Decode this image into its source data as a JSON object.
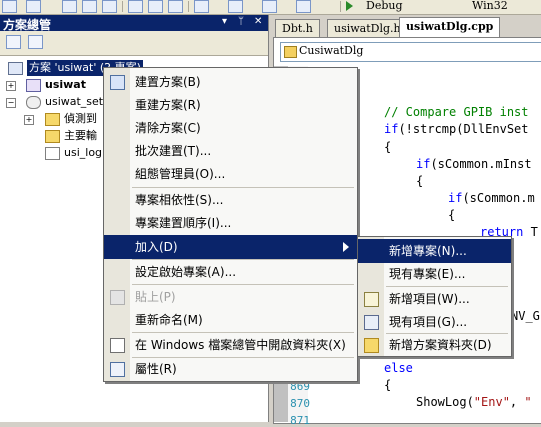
{
  "toolbar": {
    "debug_config": "Debug",
    "platform": "Win32"
  },
  "solution_explorer": {
    "title": "方案總管",
    "pin_glyph": "▾ ⊥ ✕",
    "tree": {
      "solution": "方案 'usiwat' (2 專案)",
      "project1": "usiwat",
      "project2": "usiwat_setup",
      "child_detect": "偵測到",
      "child_main": "主要輸",
      "child_log": "usi_log"
    }
  },
  "editor": {
    "tabs": [
      "Dbt.h",
      "usiwatDlg.h",
      "usiwatDlg.cpp"
    ],
    "class_combo": "CusiwatDlg",
    "code": {
      "l1_comment": "// Compare GPIB inst",
      "l2_if": "if",
      "l2_rest": "(!strcmp(DllEnvSet",
      "l3": "{",
      "l4_if": "if",
      "l4_rest": "(sCommon.mInst",
      "l5": "{",
      "l6_if": "if",
      "l6_rest": "(sCommon.m",
      "l7": "{",
      "l8_return": "return",
      "l8_rest": " T",
      "l9_rest": "NV_G",
      "l10_else": "else",
      "l11": "{",
      "l12_fn": "ShowLog(",
      "l12_str1": "\"Env\"",
      "l12_comma": ", ",
      "l12_str2": "\""
    },
    "line_numbers": [
      "869",
      "870",
      "871"
    ]
  },
  "context_menu": {
    "items": [
      {
        "label": "建置方案(B)",
        "icon": "build-icon"
      },
      {
        "label": "重建方案(R)"
      },
      {
        "label": "清除方案(C)"
      },
      {
        "label": "批次建置(T)..."
      },
      {
        "label": "組態管理員(O)..."
      },
      {
        "label": "專案相依性(S)..."
      },
      {
        "label": "專案建置順序(I)..."
      },
      {
        "label": "加入(D)"
      },
      {
        "label": "設定啟始專案(A)..."
      },
      {
        "label": "貼上(P)",
        "icon": "paste-icon"
      },
      {
        "label": "重新命名(M)"
      },
      {
        "label": "在 Windows 檔案總管中開啟資料夾(X)",
        "icon": "open-folder-icon"
      },
      {
        "label": "屬性(R)",
        "icon": "properties-icon"
      }
    ]
  },
  "submenu": {
    "items": [
      {
        "label": "新增專案(N)..."
      },
      {
        "label": "現有專案(E)..."
      },
      {
        "label": "新增項目(W)...",
        "icon": "new-item-icon"
      },
      {
        "label": "現有項目(G)...",
        "icon": "existing-item-icon"
      },
      {
        "label": "新增方案資料夾(D)",
        "icon": "solution-folder-icon"
      }
    ]
  },
  "colors": {
    "title_bar": "#0a246a",
    "highlight": "#0a246a",
    "keyword": "#0000ff",
    "comment": "#008000"
  }
}
